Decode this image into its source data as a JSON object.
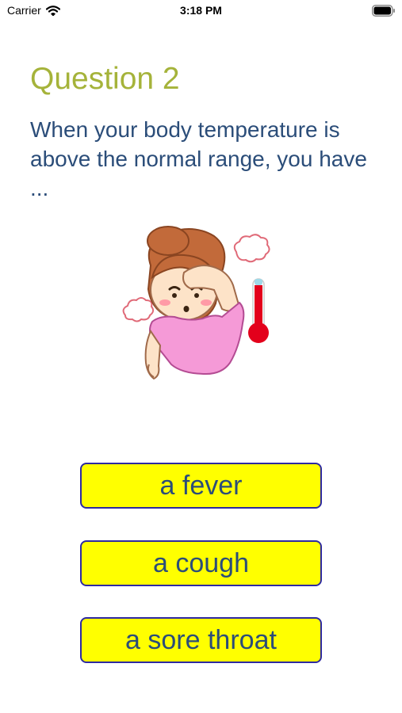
{
  "status_bar": {
    "carrier": "Carrier",
    "time": "3:18 PM",
    "icons": [
      "wifi-icon",
      "battery-icon"
    ]
  },
  "question": {
    "title": "Question 2",
    "text": "When your body temperature is above the normal range, you have ..."
  },
  "illustration": {
    "icon": "feverish-girl-with-thermometer"
  },
  "answers": [
    {
      "label": "a fever"
    },
    {
      "label": "a cough"
    },
    {
      "label": "a sore throat"
    }
  ],
  "colors": {
    "title": "#a5b33a",
    "text": "#2b4d79",
    "answer_background": "#ffff00",
    "answer_border": "#2e2aa0",
    "thermometer": "#e3001b"
  }
}
